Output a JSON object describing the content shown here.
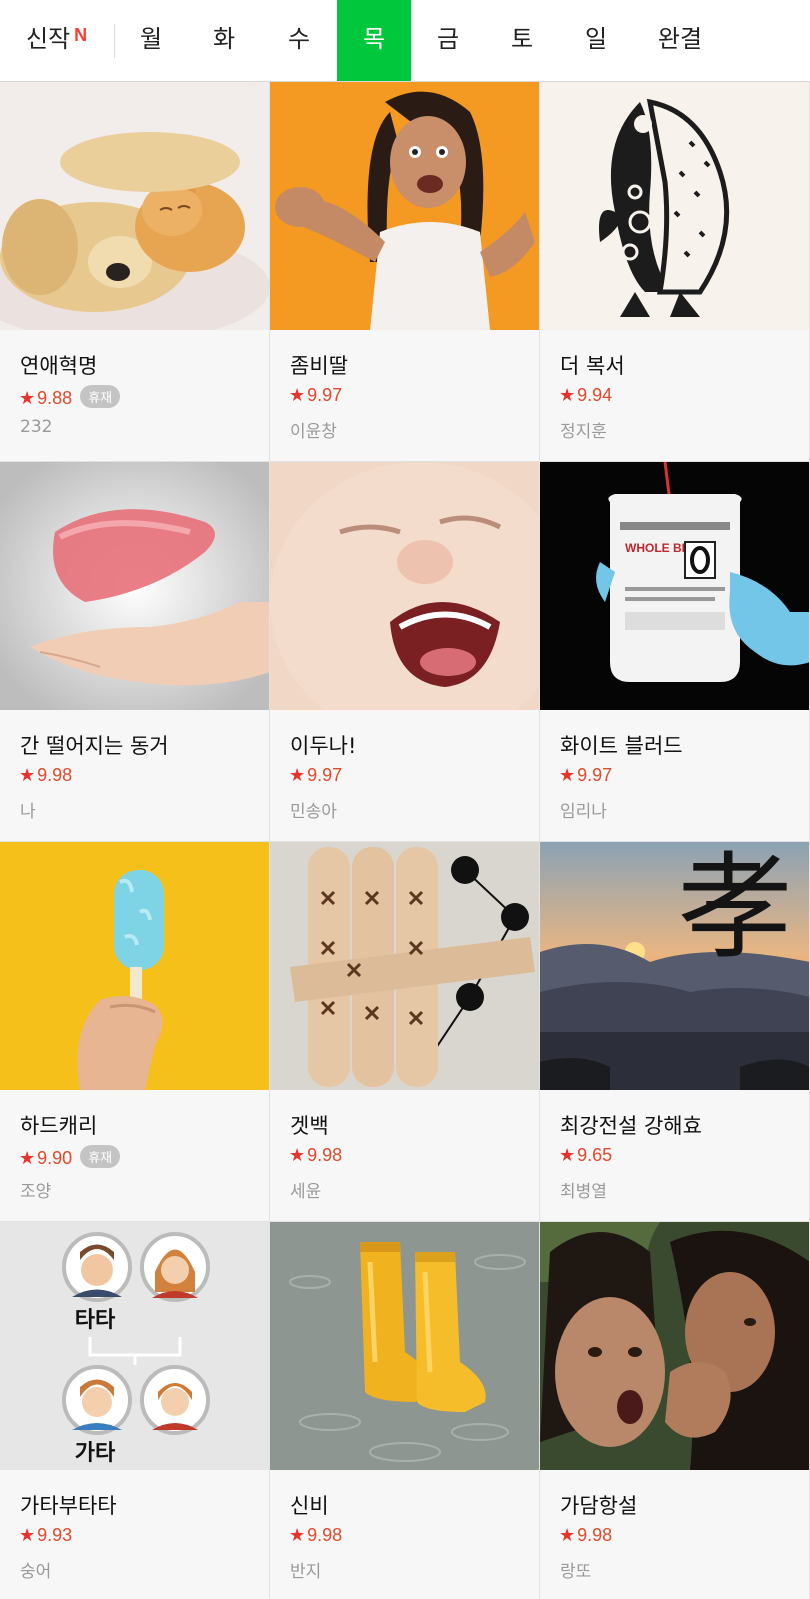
{
  "tabs": [
    {
      "label": "신작",
      "badge": "N",
      "active": false
    },
    {
      "label": "월",
      "active": false
    },
    {
      "label": "화",
      "active": false
    },
    {
      "label": "수",
      "active": false
    },
    {
      "label": "목",
      "active": true
    },
    {
      "label": "금",
      "active": false
    },
    {
      "label": "토",
      "active": false
    },
    {
      "label": "일",
      "active": false
    },
    {
      "label": "완결",
      "active": false
    }
  ],
  "accent_color": "#00c73c",
  "rating_color": "#e04a2a",
  "comics": [
    {
      "title": "연애혁명",
      "rating": "9.88",
      "badge": "휴재",
      "author": "232",
      "thumb": "puppy-kitten"
    },
    {
      "title": "좀비딸",
      "rating": "9.97",
      "author": "이윤창",
      "thumb": "zombie-girl"
    },
    {
      "title": "더 복서",
      "rating": "9.94",
      "author": "정지훈",
      "thumb": "fish-silhouette"
    },
    {
      "title": "간 떨어지는 동거",
      "rating": "9.98",
      "author": "나",
      "thumb": "liver-hand"
    },
    {
      "title": "이두나!",
      "rating": "9.97",
      "author": "민송아",
      "thumb": "crying-baby"
    },
    {
      "title": "화이트 블러드",
      "rating": "9.97",
      "author": "임리나",
      "thumb": "blood-bag"
    },
    {
      "title": "하드캐리",
      "rating": "9.90",
      "badge": "휴재",
      "author": "조양",
      "thumb": "popsicle"
    },
    {
      "title": "겟백",
      "rating": "9.98",
      "author": "세윤",
      "thumb": "yut-sticks"
    },
    {
      "title": "최강전설 강해효",
      "rating": "9.65",
      "author": "최병열",
      "thumb": "sunset-hyo",
      "thumb_text": "孝"
    },
    {
      "title": "가타부타타",
      "rating": "9.93",
      "author": "숭어",
      "thumb": "family-tree",
      "thumb_labels": [
        "타타",
        "가타"
      ]
    },
    {
      "title": "신비",
      "rating": "9.98",
      "author": "반지",
      "thumb": "yellow-boots"
    },
    {
      "title": "가담항설",
      "rating": "9.98",
      "author": "랑또",
      "thumb": "whispering-women"
    }
  ]
}
